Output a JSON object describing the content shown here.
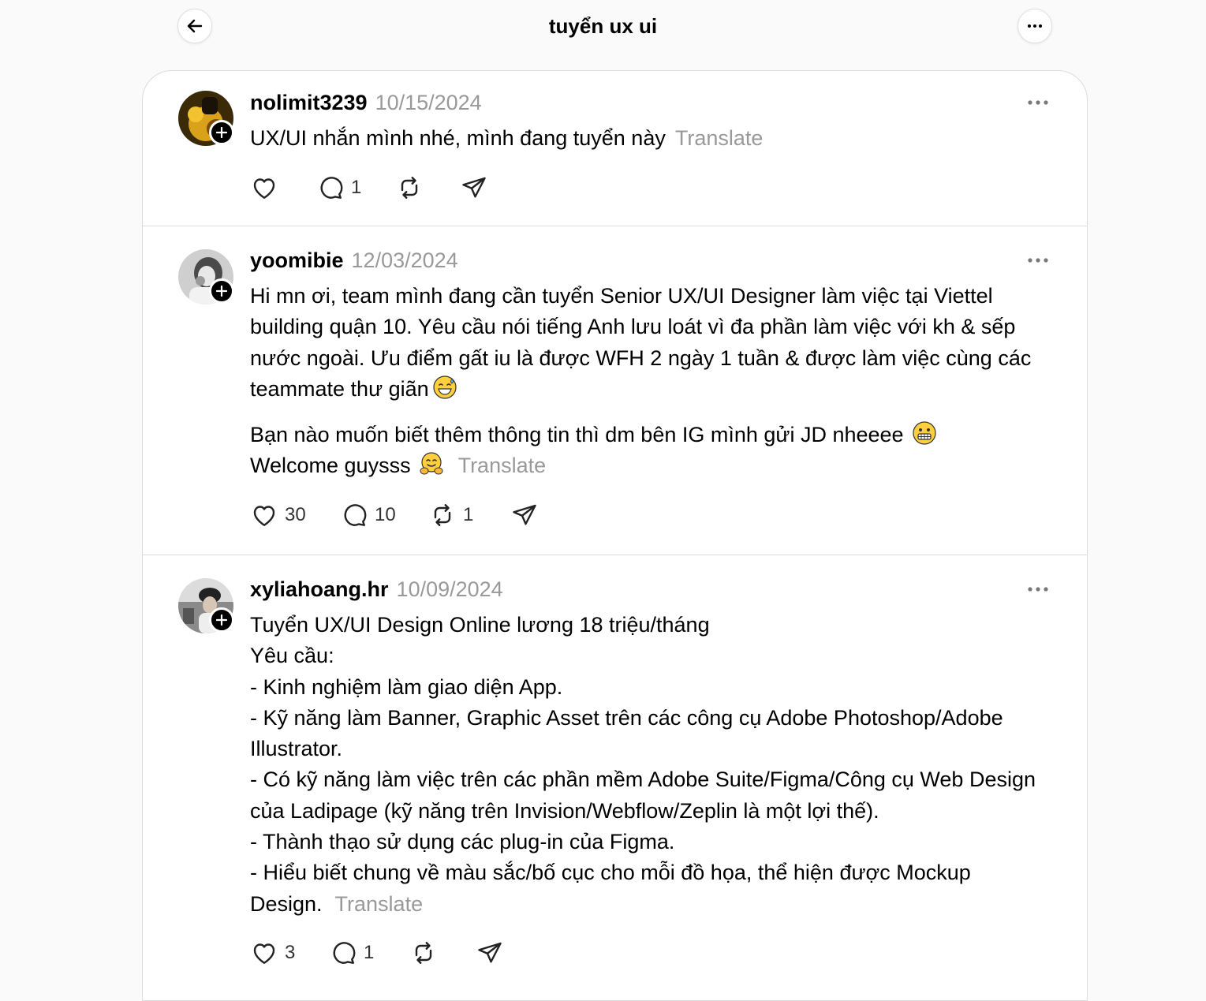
{
  "header": {
    "title": "tuyển ux ui"
  },
  "posts": [
    {
      "username": "nolimit3239",
      "date": "10/15/2024",
      "body": [
        "UX/UI nhắn mình nhé, mình đang tuyển này"
      ],
      "translate_label": "Translate",
      "likes": "",
      "replies": "1",
      "reposts": ""
    },
    {
      "username": "yoomibie",
      "date": "12/03/2024",
      "body_p1": "Hi mn ơi, team mình đang cần tuyển Senior UX/UI Designer làm việc tại Viettel building quận 10. Yêu cầu nói tiếng Anh lưu loát vì đa phần làm việc với kh & sếp nước ngoài. Ưu điểm gất iu là được WFH 2 ngày 1 tuần & được làm việc cùng các teammate thư giãn",
      "body_p2a": "Bạn nào muốn biết thêm thông tin thì dm bên IG mình gửi JD nheeee",
      "body_p2b": "Welcome guysss",
      "translate_label": "Translate",
      "likes": "30",
      "replies": "10",
      "reposts": "1"
    },
    {
      "username": "xyliahoang.hr",
      "date": "10/09/2024",
      "lines": [
        "Tuyển UX/UI Design Online lương 18 triệu/tháng",
        "Yêu cầu:",
        "- Kinh nghiệm làm giao diện App.",
        "- Kỹ năng làm Banner, Graphic Asset trên các công cụ Adobe Photoshop/Adobe Illustrator.",
        "- Có kỹ năng làm việc trên các phần mềm Adobe Suite/Figma/Công cụ Web Design của Ladipage (kỹ năng trên Invision/Webflow/Zeplin là một lợi thế).",
        "- Thành thạo sử dụng các plug-in của Figma.",
        "- Hiểu biết chung về màu sắc/bố cục cho mỗi đồ họa, thể hiện được Mockup Design."
      ],
      "translate_label": "Translate",
      "likes": "3",
      "replies": "1",
      "reposts": ""
    }
  ],
  "icons": {
    "back": "arrow-left-icon",
    "more": "more-horizontal-icon",
    "like": "heart-icon",
    "reply": "comment-icon",
    "repost": "repost-icon",
    "share": "send-icon",
    "follow": "plus-icon"
  }
}
